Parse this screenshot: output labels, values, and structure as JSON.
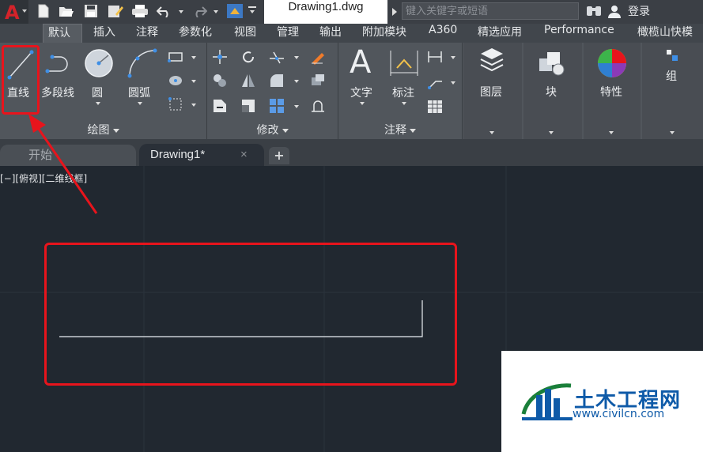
{
  "titlebar": {
    "document_title": "Drawing1.dwg",
    "search_placeholder": "键入关键字或短语",
    "login_label": "登录",
    "app_icon": "A"
  },
  "ribbon_tabs": [
    "默认",
    "插入",
    "注释",
    "参数化",
    "视图",
    "管理",
    "输出",
    "附加模块",
    "A360",
    "精选应用",
    "Performance",
    "橄榄山快模"
  ],
  "active_tab_index": 0,
  "draw_panel": {
    "title": "绘图",
    "tools": {
      "line": "直线",
      "polyline": "多段线",
      "circle": "圆",
      "arc": "圆弧"
    }
  },
  "modify_panel": {
    "title": "修改"
  },
  "annotation_panel": {
    "title": "注释",
    "tools": {
      "text": "文字",
      "dimension": "标注",
      "text_glyph": "A"
    }
  },
  "layers_panel": {
    "label": "图层"
  },
  "block_panel": {
    "label": "块"
  },
  "properties_panel": {
    "label": "特性"
  },
  "groups_panel": {
    "label": "组"
  },
  "file_tabs": {
    "start": "开始",
    "drawing": "Drawing1*",
    "close_glyph": "×",
    "add_glyph": "+"
  },
  "viewport_label": "[−][俯视][二维线框]",
  "watermark": {
    "name": "土木工程网",
    "url": "www.civilcn.com"
  },
  "colors": {
    "highlight_red": "#e8141c",
    "canvas": "#212830",
    "ribbon": "#51565c",
    "accent_blue": "#2f7fd1"
  }
}
